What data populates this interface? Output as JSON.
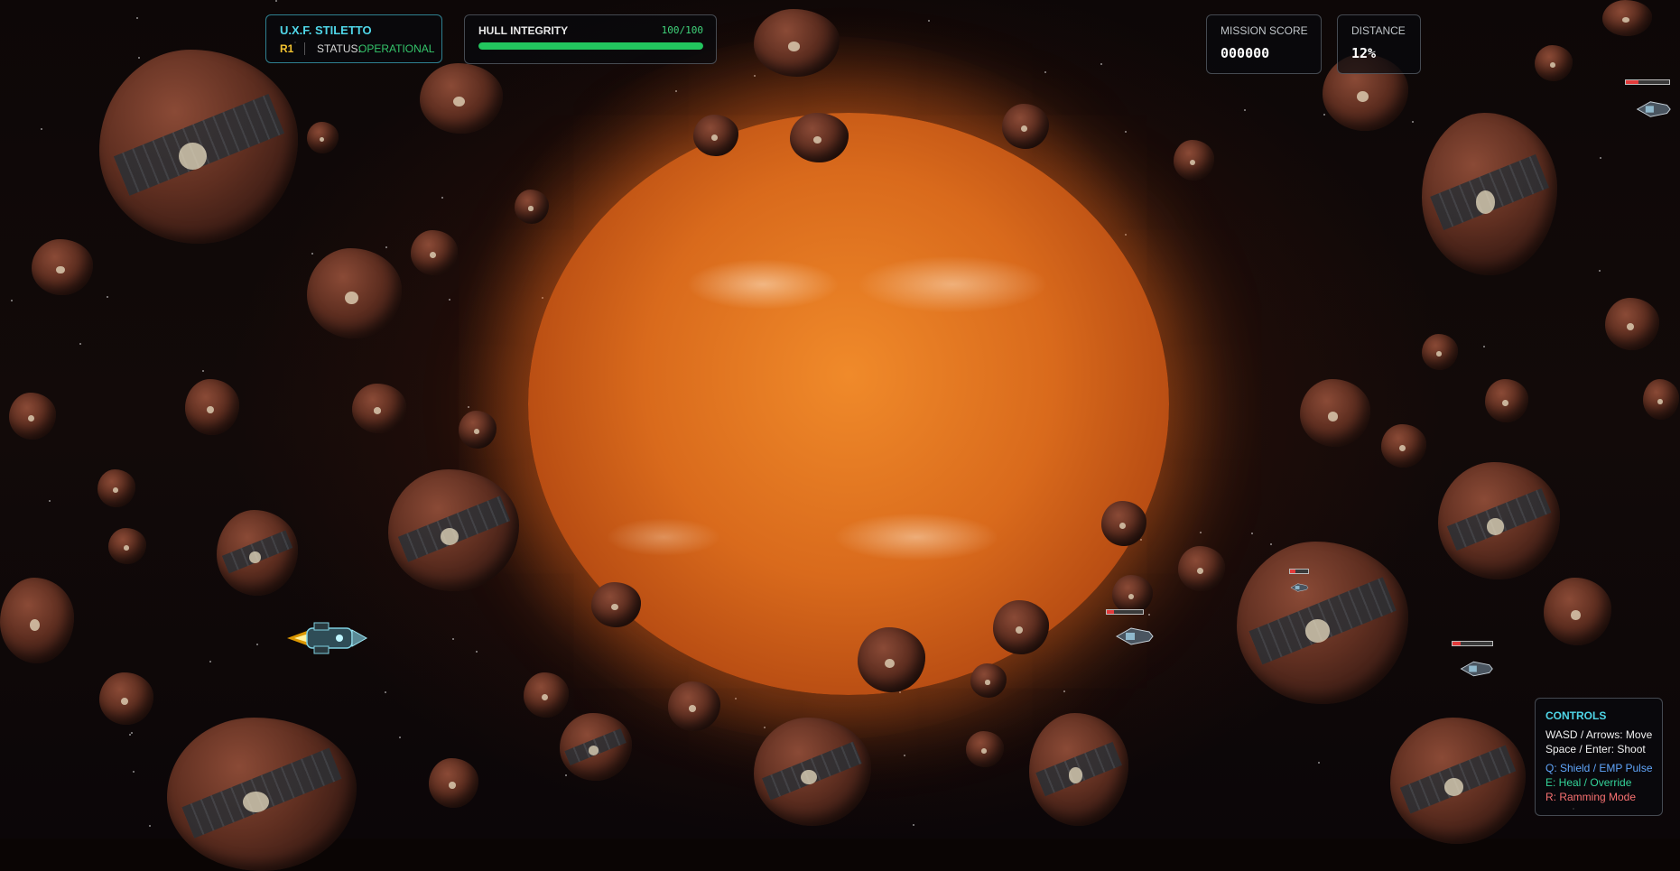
{
  "ship": {
    "name": "U.X.F. STILETTO",
    "rank": "R1",
    "status_label": "STATUS:",
    "status_value": "OPERATIONAL"
  },
  "hull": {
    "label": "HULL INTEGRITY",
    "value_text": "100/100",
    "fraction": 1.0
  },
  "mission_score": {
    "label": "MISSION SCORE",
    "value": "000000"
  },
  "distance": {
    "label": "DISTANCE",
    "value": "12%"
  },
  "controls": {
    "title": "CONTROLS",
    "move": "WASD / Arrows: Move",
    "shoot": "Space / Enter: Shoot",
    "shield": "Q: Shield / EMP Pulse",
    "heal": "E: Heal / Override",
    "ram": "R: Ramming Mode"
  },
  "enemies": [
    {
      "health_fraction": 0.2
    },
    {
      "health_fraction": 0.3
    },
    {
      "health_fraction": 0.2
    },
    {
      "health_fraction": 0.3
    }
  ],
  "colors": {
    "accent_cyan": "#4fd6e8",
    "rank_yellow": "#f2c230",
    "status_green": "#34c46a",
    "hull_green": "#22c55e",
    "enemy_health_red": "#e23b3b"
  }
}
